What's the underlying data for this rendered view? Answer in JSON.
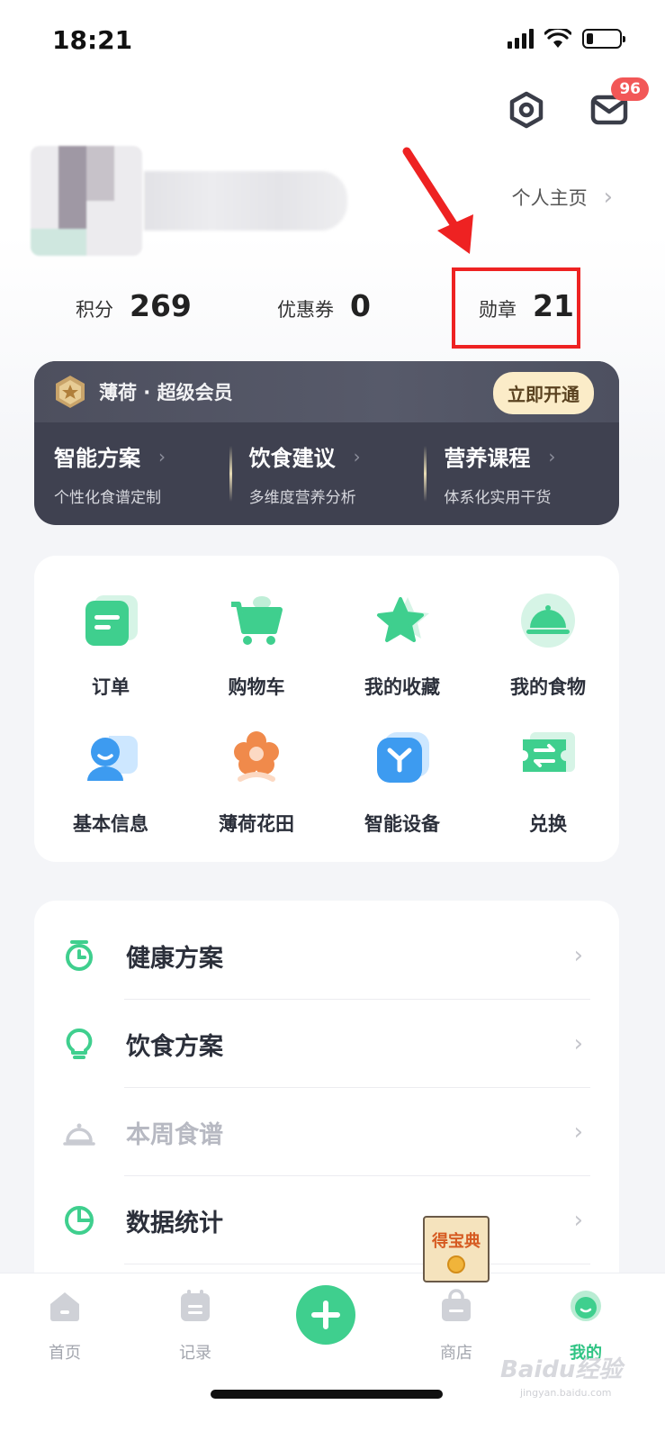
{
  "status_bar": {
    "time": "18:21"
  },
  "header": {
    "notification_count": "96"
  },
  "profile": {
    "homepage_link": "个人主页"
  },
  "stats": [
    {
      "label": "积分",
      "value": "269"
    },
    {
      "label": "优惠券",
      "value": "0"
    },
    {
      "label": "勋章",
      "value": "21"
    }
  ],
  "member": {
    "title": "薄荷 · 超级会员",
    "button": "立即开通",
    "columns": [
      {
        "title": "智能方案",
        "subtitle": "个性化食谱定制"
      },
      {
        "title": "饮食建议",
        "subtitle": "多维度营养分析"
      },
      {
        "title": "营养课程",
        "subtitle": "体系化实用干货"
      }
    ]
  },
  "grid": {
    "items": [
      {
        "label": "订单",
        "icon": "order-icon"
      },
      {
        "label": "购物车",
        "icon": "cart-icon"
      },
      {
        "label": "我的收藏",
        "icon": "star-icon"
      },
      {
        "label": "我的食物",
        "icon": "food-cloche-icon"
      },
      {
        "label": "基本信息",
        "icon": "person-icon"
      },
      {
        "label": "薄荷花田",
        "icon": "flower-icon"
      },
      {
        "label": "智能设备",
        "icon": "device-icon"
      },
      {
        "label": "兑换",
        "icon": "exchange-icon"
      }
    ]
  },
  "menu": {
    "items": [
      {
        "label": "健康方案",
        "icon": "timer-icon"
      },
      {
        "label": "饮食方案",
        "icon": "bulb-icon"
      },
      {
        "label": "本周食谱",
        "icon": "cloche-icon"
      },
      {
        "label": "数据统计",
        "icon": "pie-chart-icon"
      }
    ]
  },
  "promo": {
    "label": "得宝典"
  },
  "tabs": [
    {
      "label": "首页",
      "icon": "home-icon"
    },
    {
      "label": "记录",
      "icon": "record-icon"
    },
    {
      "label": "商店",
      "icon": "shop-icon"
    },
    {
      "label": "我的",
      "icon": "me-icon"
    }
  ],
  "watermark": {
    "text": "Baidu经验",
    "sub": "jingyan.baidu.com"
  },
  "colors": {
    "accent": "#3fcf8e",
    "highlight": "#ee2222",
    "member_bg": "#3f4150",
    "badge": "#f25757"
  }
}
